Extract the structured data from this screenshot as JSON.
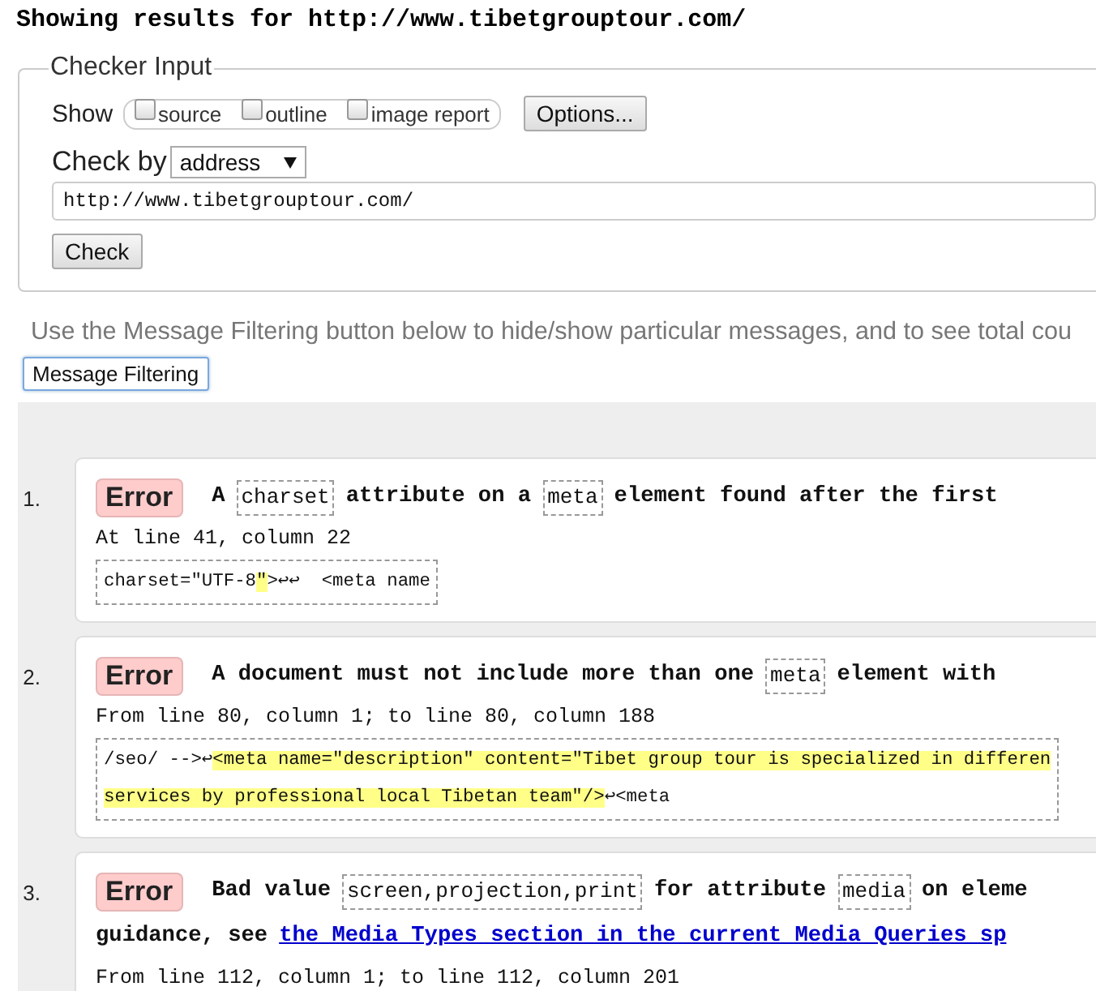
{
  "heading": "Showing results for http://www.tibetgrouptour.com/",
  "checker": {
    "legend": "Checker Input",
    "show_label": "Show",
    "show_options": [
      {
        "label": "source",
        "checked": false
      },
      {
        "label": "outline",
        "checked": false
      },
      {
        "label": "image report",
        "checked": false
      }
    ],
    "options_button": "Options...",
    "check_by_label": "Check by",
    "check_by_value": "address",
    "url": "http://www.tibetgrouptour.com/",
    "check_button": "Check"
  },
  "info": "Use the Message Filtering button below to hide/show particular messages, and to see total cou",
  "filter_button": "Message Filtering",
  "messages": [
    {
      "number": "1.",
      "type": "Error",
      "title_lines": [
        [
          {
            "kind": "text",
            "text": "A"
          },
          {
            "kind": "code",
            "text": "charset"
          },
          {
            "kind": "text",
            "text": "attribute on a"
          },
          {
            "kind": "code",
            "text": "meta"
          },
          {
            "kind": "text",
            "text": "element found after the first"
          }
        ]
      ],
      "location": "At line 41, column 22",
      "extract": [
        [
          {
            "text": "charset=\"UTF-8",
            "highlighted": false
          },
          {
            "text": "\"",
            "highlighted": true
          },
          {
            "text": ">↩↩  <meta name",
            "highlighted": false
          }
        ]
      ]
    },
    {
      "number": "2.",
      "type": "Error",
      "title_lines": [
        [
          {
            "kind": "text",
            "text": "A document must not include more than one"
          },
          {
            "kind": "code",
            "text": "meta"
          },
          {
            "kind": "text",
            "text": "element with"
          }
        ]
      ],
      "location": "From line 80, column 1; to line 80, column 188",
      "extract": [
        [
          {
            "text": "/seo/ -->↩",
            "highlighted": false
          },
          {
            "text": "<meta name=\"description\" content=\"Tibet group tour is specialized in differen",
            "highlighted": true
          }
        ],
        [
          {
            "text": "services by professional local Tibetan team\"/>",
            "highlighted": true
          },
          {
            "text": "↩<meta",
            "highlighted": false
          }
        ]
      ]
    },
    {
      "number": "3.",
      "type": "Error",
      "title_lines": [
        [
          {
            "kind": "text",
            "text": "Bad value"
          },
          {
            "kind": "code",
            "text": "screen,projection,print"
          },
          {
            "kind": "text",
            "text": "for attribute"
          },
          {
            "kind": "code",
            "text": "media"
          },
          {
            "kind": "text",
            "text": "on eleme"
          }
        ],
        [
          {
            "kind": "text",
            "text": "guidance, see"
          },
          {
            "kind": "link",
            "text": "the Media Types section in the current Media Queries sp"
          }
        ]
      ],
      "location": "From line 112, column 1; to line 112, column 201"
    }
  ]
}
